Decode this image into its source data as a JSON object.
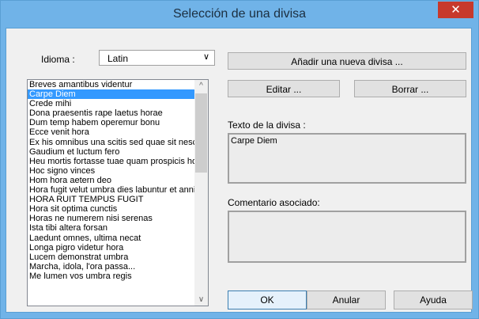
{
  "window": {
    "title": "Selección de una divisa",
    "close_glyph": "✕"
  },
  "idioma": {
    "label": "Idioma :",
    "value": "Latin",
    "arrow": "∨"
  },
  "buttons": {
    "add": "Añadir una nueva divisa ...",
    "edit": "Editar ...",
    "delete": "Borrar ...",
    "ok": "OK",
    "cancel": "Anular",
    "help": "Ayuda"
  },
  "mottos": {
    "selected_index": 1,
    "items": [
      "Breves amantibus videntur",
      "Carpe Diem",
      "Crede mihi",
      "Dona praesentis rape laetus horae",
      "Dum temp habem operemur bonu",
      "Ecce venit hora",
      "Ex his omnibus una scitis sed quae sit nesc",
      "Gaudium et luctum fero",
      "Heu mortis fortasse tuae quam prospicis ho",
      "Hoc signo vinces",
      "Hom hora aetern deo",
      "Hora fugit velut umbra dies labuntur et anni",
      "HORA RUIT TEMPUS FUGIT",
      "Hora sit optima cunctis",
      "Horas ne numerem nisi serenas",
      "Ista tibi altera forsan",
      "Laedunt omnes, ultima necat",
      "Longa pigro videtur hora",
      "Lucem demonstrat umbra",
      "Marcha, idola, l'ora passa...",
      "Me lumen vos umbra regis"
    ],
    "scroll_up": "^",
    "scroll_down": "∨"
  },
  "divisa_text": {
    "label": "Texto de la divisa :",
    "value": "Carpe Diem"
  },
  "comment": {
    "label": "Comentario asociado:",
    "value": ""
  },
  "icons": {
    "close": "close-icon",
    "dropdown": "chevron-down-icon"
  }
}
